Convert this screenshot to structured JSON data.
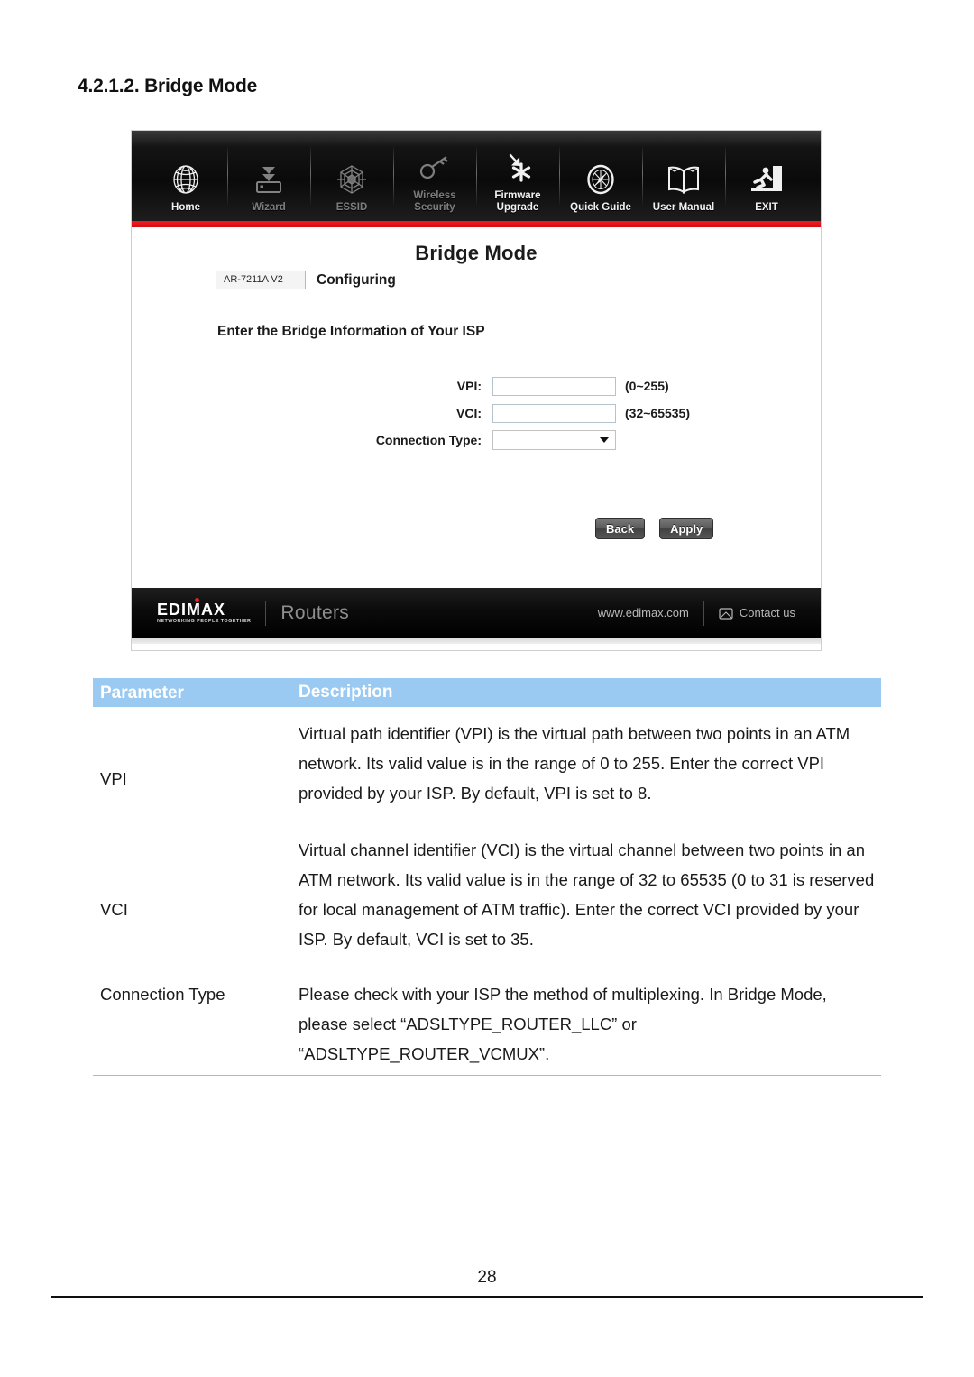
{
  "document": {
    "section_heading": "4.2.1.2. Bridge Mode",
    "page_number": "28"
  },
  "router_ui": {
    "toolbar": [
      {
        "label": "Home",
        "icon": "globe-icon",
        "state": "active"
      },
      {
        "label": "Wizard",
        "icon": "wizard-download-icon",
        "state": "disabled"
      },
      {
        "label": "ESSID",
        "icon": "essid-web-icon",
        "state": "disabled"
      },
      {
        "label": "Wireless\nSecurity",
        "icon": "key-icon",
        "state": "disabled"
      },
      {
        "label": "Firmware\nUpgrade",
        "icon": "firmware-upgrade-icon",
        "state": "active"
      },
      {
        "label": "Quick Guide",
        "icon": "compass-icon",
        "state": "active"
      },
      {
        "label": "User Manual",
        "icon": "open-book-icon",
        "state": "active"
      },
      {
        "label": "EXIT",
        "icon": "exit-running-person-icon",
        "state": "active"
      }
    ],
    "accent_color": "#e8171f",
    "page_title": "Bridge Mode",
    "model_badge": "AR-7211A V2",
    "status_text": "Configuring",
    "instruction": "Enter the Bridge Information of Your ISP",
    "form": {
      "vpi": {
        "label": "VPI:",
        "value": "",
        "placeholder": "",
        "hint": "(0~255)"
      },
      "vci": {
        "label": "VCI:",
        "value": "",
        "placeholder": "",
        "hint": "(32~65535)"
      },
      "connection_type": {
        "label": "Connection Type:",
        "value": "",
        "hint": ""
      }
    },
    "buttons": {
      "back": "Back",
      "apply": "Apply"
    },
    "footer": {
      "brand": "EDIMAX",
      "tagline": "NETWORKING PEOPLE TOGETHER",
      "category": "Routers",
      "website": "www.edimax.com",
      "contact": "Contact us"
    }
  },
  "param_table": {
    "headers": {
      "parameter": "Parameter",
      "description": "Description"
    },
    "rows": [
      {
        "parameter": "VPI",
        "description": "Virtual path identifier (VPI) is the virtual path between two points in an ATM network. Its valid value is in the range of 0 to 255. Enter the correct VPI provided by your ISP. By default, VPI is set to 8."
      },
      {
        "parameter": "VCI",
        "description": "Virtual channel identifier (VCI) is the virtual channel between two points in an ATM network. Its valid value is in the range of 32 to 65535 (0 to 31 is reserved for local management of ATM traffic). Enter the correct VCI provided by your ISP. By default, VCI is set to 35."
      },
      {
        "parameter": "Connection Type",
        "description": "Please check with your ISP the method of multiplexing. In Bridge Mode, please select “ADSLTYPE_ROUTER_LLC” or “ADSLTYPE_ROUTER_VCMUX”."
      }
    ]
  }
}
